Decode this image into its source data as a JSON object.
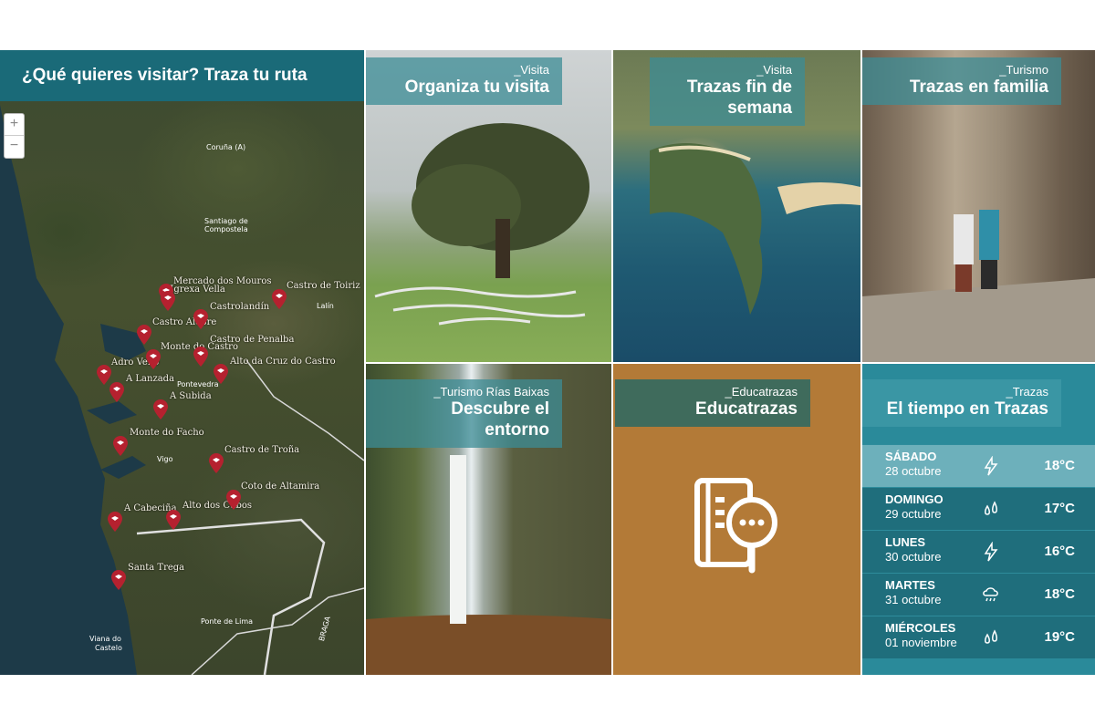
{
  "map": {
    "header": "¿Qué quieres visitar? Traza tu ruta",
    "zoom_in": "+",
    "zoom_out": "−",
    "cities": [
      "Coruña (A)",
      "Santiago de",
      "Compostela",
      "Pontevedra",
      "Vigo",
      "Lalín",
      "Ponte de Lima",
      "Viana do",
      "Castelo",
      "BRAGA"
    ],
    "places": [
      "Mercado dos Mouros",
      "A Igrexa Vella",
      "Castro de Toiriz",
      "Castrolandín",
      "Castro Alobre",
      "Castro de Penalba",
      "Monte do Castro",
      "Adro Vello",
      "Alto da Cruz do Castro",
      "A Lanzada",
      "A Subida",
      "Monte do Facho",
      "Castro de Troña",
      "Coto de Altamira",
      "A Cabeciña",
      "Alto dos Cubos",
      "Santa Trega"
    ]
  },
  "tiles": [
    {
      "kicker": "_Visita",
      "title": "Organiza tu visita"
    },
    {
      "kicker": "_Visita",
      "title": "Trazas fin de semana"
    },
    {
      "kicker": "_Turismo",
      "title": "Trazas en familia"
    },
    {
      "kicker": "_Turismo Rías Baixas",
      "title": "Descubre el entorno"
    },
    {
      "kicker": "_Educatrazas",
      "title": "Educatrazas"
    },
    {
      "kicker": "_Trazas",
      "title": "El tiempo en Trazas"
    }
  ],
  "weather": [
    {
      "day": "SÁBADO",
      "date": "28 octubre",
      "icon": "lightning-icon",
      "temp": "18°C"
    },
    {
      "day": "DOMINGO",
      "date": "29 octubre",
      "icon": "rain-drops-icon",
      "temp": "17°C"
    },
    {
      "day": "LUNES",
      "date": "30 octubre",
      "icon": "lightning-icon",
      "temp": "16°C"
    },
    {
      "day": "MARTES",
      "date": "31 octubre",
      "icon": "cloud-rain-icon",
      "temp": "18°C"
    },
    {
      "day": "MIÉRCOLES",
      "date": "01 noviembre",
      "icon": "rain-drops-icon",
      "temp": "19°C"
    }
  ],
  "colors": {
    "teal": "#1a6a78",
    "pin": "#b5212f",
    "edu_bg": "#b37a37",
    "edu_label": "#3f6b5c"
  }
}
